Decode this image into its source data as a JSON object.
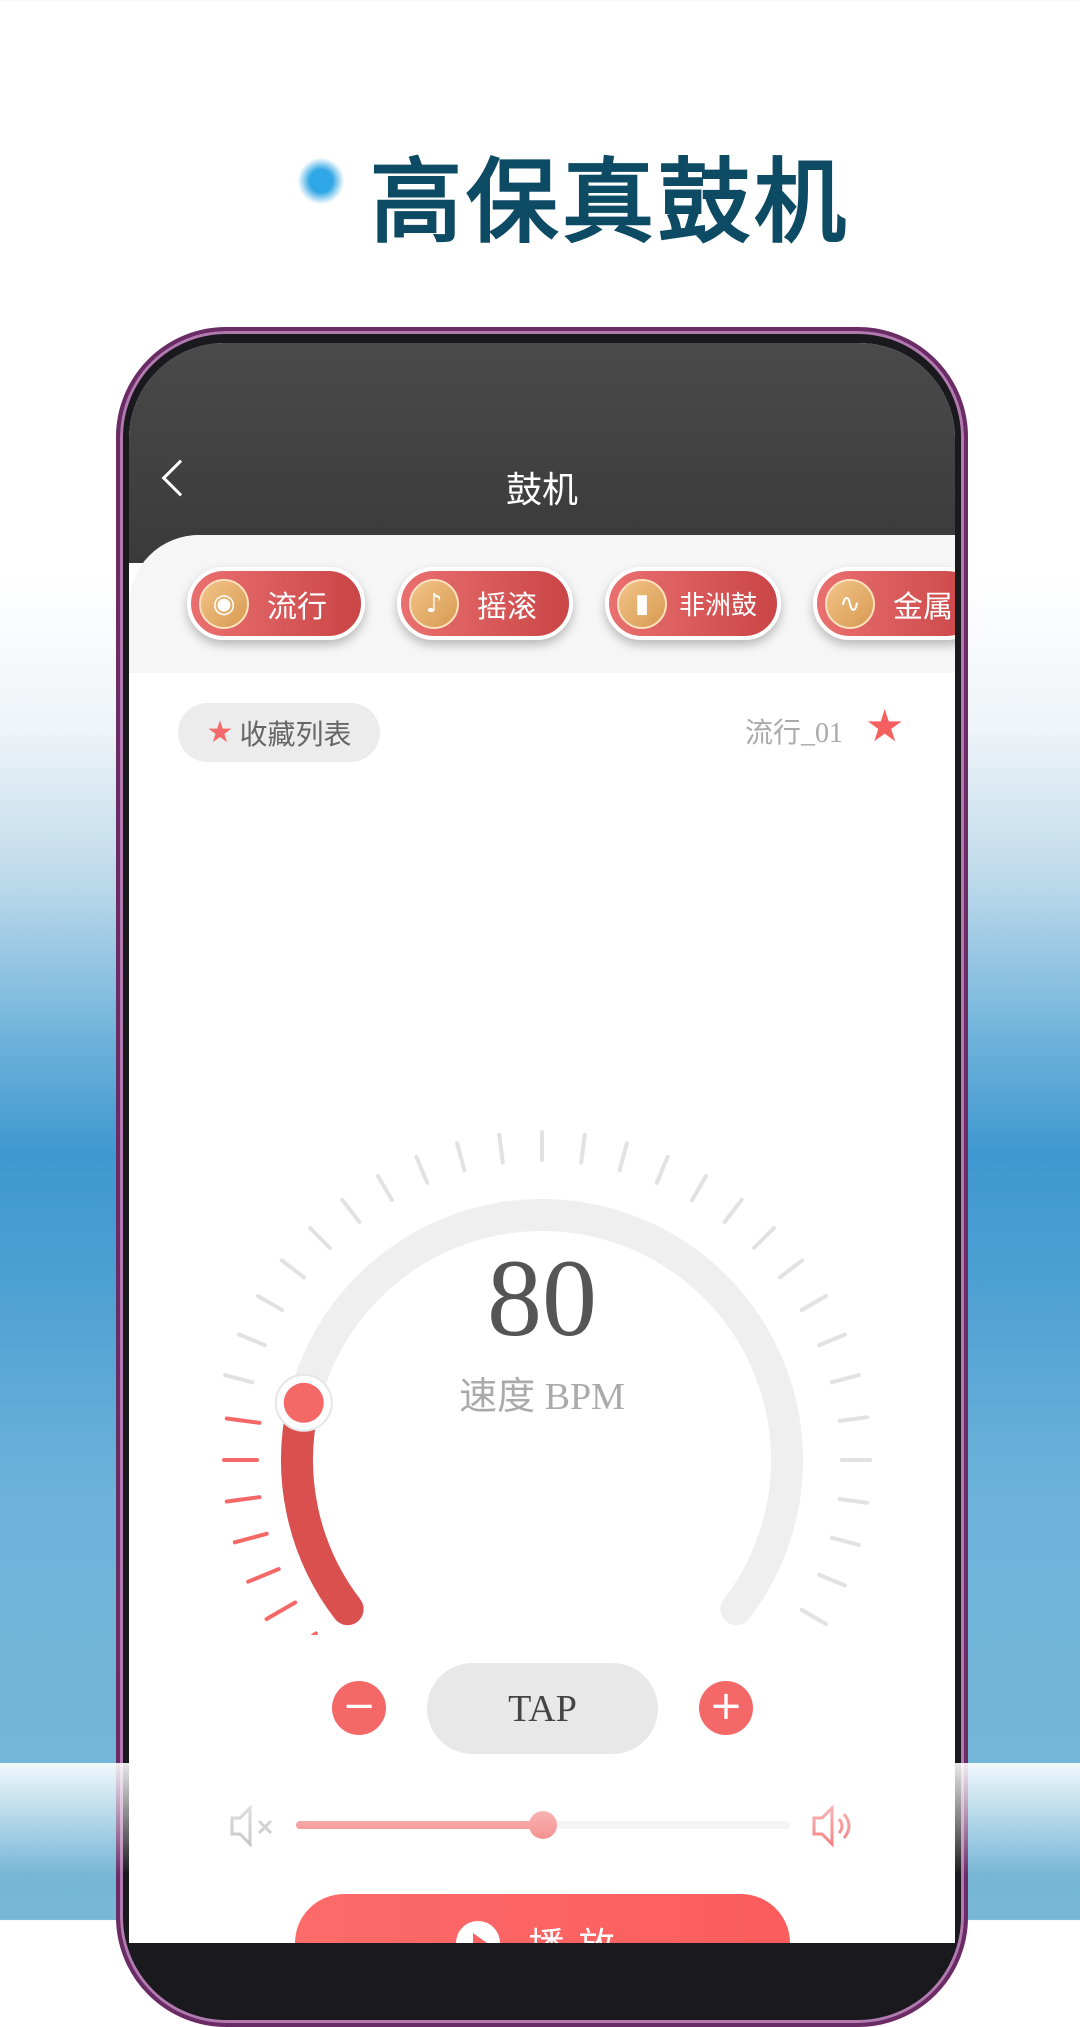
{
  "promo": {
    "title": "高保真鼓机"
  },
  "header": {
    "title": "鼓机"
  },
  "categories": [
    {
      "label": "流行",
      "icon": "disc-icon"
    },
    {
      "label": "摇滚",
      "icon": "guitar-icon"
    },
    {
      "label": "非洲鼓",
      "icon": "drum-icon"
    },
    {
      "label": "金属",
      "icon": "waveform-icon"
    }
  ],
  "favorites": {
    "label": "收藏列表"
  },
  "current_pattern": "流行_01",
  "tempo": {
    "value": "80",
    "label": "速度 BPM",
    "fraction": 0.2
  },
  "controls": {
    "minus": "−",
    "tap": "TAP",
    "plus": "+"
  },
  "volume": {
    "level": 0.5
  },
  "play": {
    "label": "播放"
  },
  "colors": {
    "accent": "#f46868",
    "title": "#0d4a63",
    "header": "#444444"
  }
}
